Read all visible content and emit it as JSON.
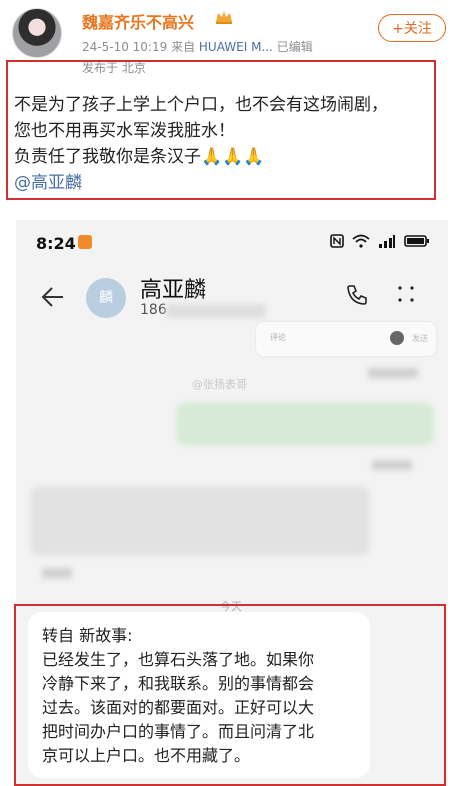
{
  "post": {
    "username": "魏嘉齐乐不高兴",
    "timestamp": "24-5-10 10:19",
    "source_prefix": "来自",
    "source": "HUAWEI M...",
    "edited": "已编辑",
    "location": "发布于 北京",
    "follow_label": "+关注",
    "lines": [
      "不是为了孩子上学上个户口，也不会有这场闹剧，",
      "您也不用再买水军泼我脏水！",
      "负责任了我敬你是条汉子🙏🙏🙏"
    ],
    "mention": "@高亚麟"
  },
  "screenshot": {
    "time": "8:24",
    "contact_name": "高亚麟",
    "contact_avatar_text": "麟",
    "contact_phone_prefix": "186",
    "comment_hint": "评论",
    "send_hint": "发送",
    "watermark": "@张扬表哥",
    "date_divider": "今天",
    "message_lines": [
      "转自 新故事:",
      "已经发生了，也算石头落了地。如果你",
      "冷静下来了，和我联系。别的事情都会",
      "过去。该面对的都要面对。正好可以大",
      "把时间办户口的事情了。而且问清了北",
      "京可以上户口。也不用藏了。"
    ]
  },
  "icons": {
    "crown": "crown-icon",
    "back": "back-arrow-icon",
    "call": "phone-call-icon",
    "more": "more-options-icon",
    "nfc": "nfc-icon",
    "wifi": "wifi-icon",
    "signal": "signal-icon",
    "battery": "battery-icon",
    "emoji": "emoji-icon"
  },
  "colors": {
    "username": "#e8761f",
    "follow": "#e06a1f",
    "highlight_box": "#d0302e",
    "mention": "#4a6fa5"
  }
}
